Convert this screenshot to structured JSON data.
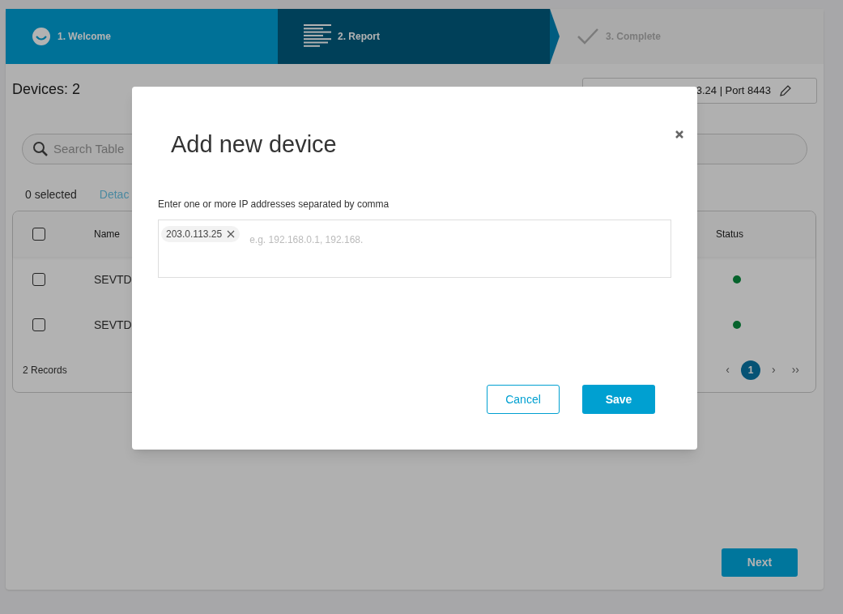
{
  "steps": [
    {
      "label": "1. Welcome",
      "kind": "welcome",
      "visited": true,
      "selected": false
    },
    {
      "label": "2. Report",
      "kind": "report",
      "visited": true,
      "selected": true
    },
    {
      "label": "3. Complete",
      "kind": "complete",
      "visited": false,
      "selected": false
    }
  ],
  "devices_title": "Devices: 2",
  "server_field": {
    "value": "3.24 | Port 8443"
  },
  "search": {
    "placeholder": "Search Table"
  },
  "selection": {
    "count": "0 selected",
    "link": "Detac"
  },
  "table": {
    "header_checked": false,
    "columns": [
      "Name",
      "Status"
    ],
    "rows": [
      {
        "checked": false,
        "name": "SEVTD",
        "color": "#07642c"
      },
      {
        "checked": false,
        "name": "SEVTD",
        "color": "#07642c"
      }
    ],
    "records": "2 Records",
    "pagination": {
      "prev": "‹",
      "pages": [
        {
          "label": "1",
          "selected": true
        }
      ],
      "next": "›",
      "last": "››"
    }
  },
  "next_button": "Next",
  "modal": {
    "title": "Add new device",
    "label": "Enter one or more IP addresses separated by comma",
    "tags": [
      {
        "text": "203.0.113.25"
      }
    ],
    "placeholder": "e.g. 192.168.0.1, 192.168.",
    "buttons": [
      {
        "label": "Cancel",
        "kind": "secondary"
      },
      {
        "label": "Save",
        "kind": "primary"
      }
    ]
  }
}
